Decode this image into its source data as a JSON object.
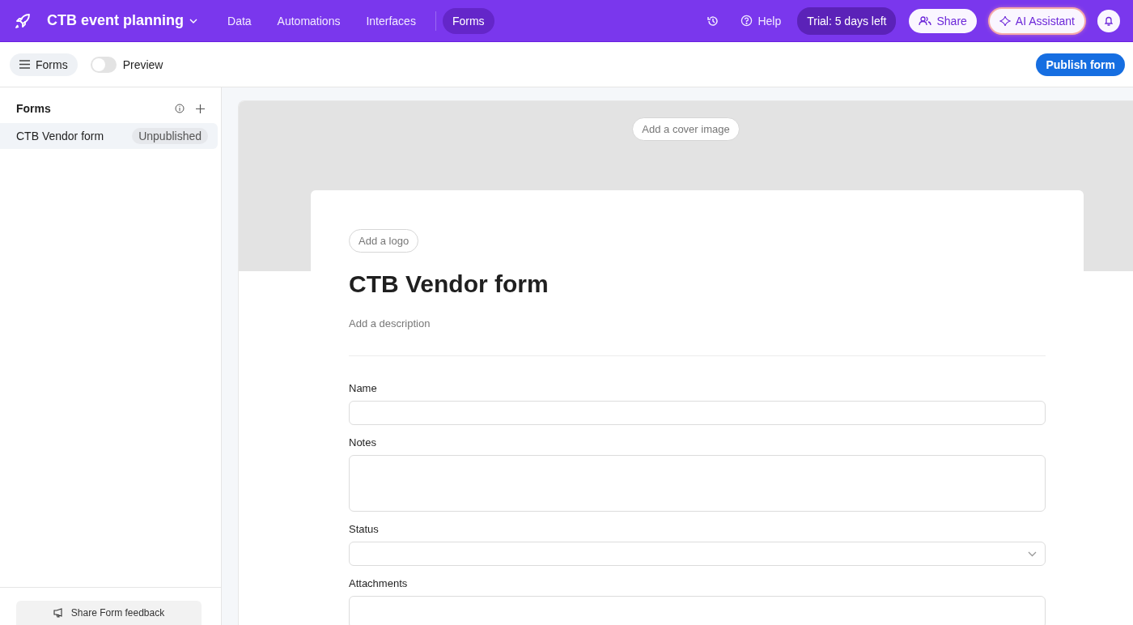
{
  "topbar": {
    "base_name": "CTB event planning",
    "nav": [
      {
        "label": "Data",
        "selected": false
      },
      {
        "label": "Automations",
        "selected": false
      },
      {
        "label": "Interfaces",
        "selected": false
      },
      {
        "label": "Forms",
        "selected": true
      }
    ],
    "help": "Help",
    "trial": "Trial: 5 days left",
    "share": "Share",
    "ai": "AI Assistant"
  },
  "toolbar": {
    "forms_button": "Forms",
    "preview": {
      "label": "Preview",
      "on": false
    },
    "publish": "Publish form"
  },
  "sidebar": {
    "title": "Forms",
    "items": [
      {
        "name": "CTB Vendor form",
        "status": "Unpublished",
        "selected": true
      }
    ],
    "feedback": "Share Form feedback"
  },
  "form": {
    "cover_button": "Add a cover image",
    "logo_button": "Add a logo",
    "title": "CTB Vendor form",
    "description_placeholder": "Add a description",
    "fields": [
      {
        "label": "Name",
        "kind": "text"
      },
      {
        "label": "Notes",
        "kind": "textarea"
      },
      {
        "label": "Status",
        "kind": "select"
      },
      {
        "label": "Attachments",
        "kind": "attachment"
      }
    ]
  }
}
